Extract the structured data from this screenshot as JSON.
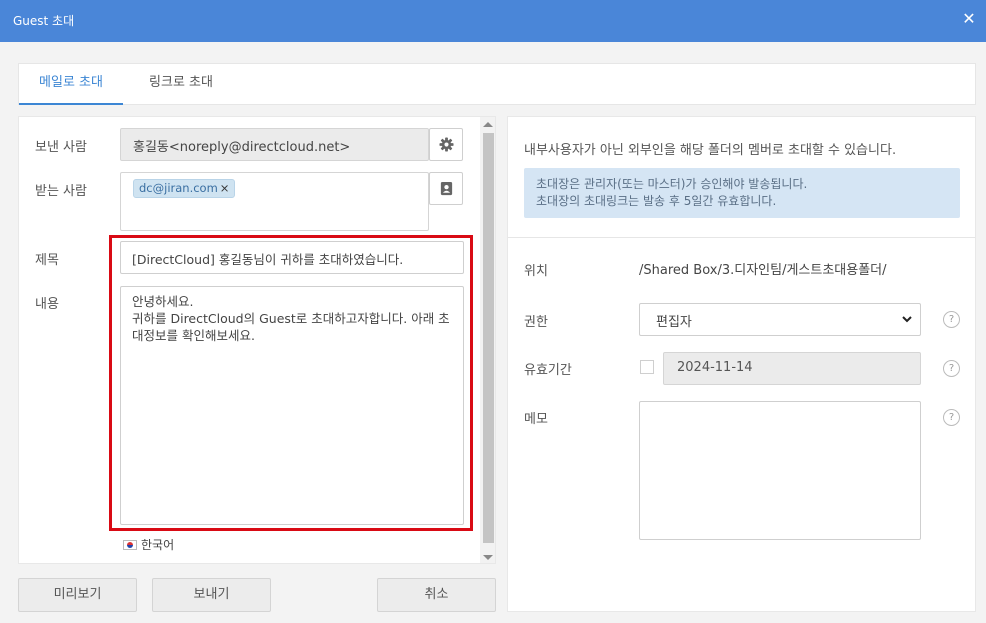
{
  "window": {
    "title": "Guest 초대"
  },
  "tabs": [
    {
      "label": "메일로 초대",
      "active": true
    },
    {
      "label": "링크로 초대",
      "active": false
    }
  ],
  "form": {
    "sender_label": "보낸 사람",
    "sender_value": "홍길동<noreply@directcloud.net>",
    "recipient_label": "받는 사람",
    "recipient_chips": [
      "dc@jiran.com"
    ],
    "subject_label": "제목",
    "subject_value": "[DirectCloud] 홍길동님이 귀하를 초대하였습니다.",
    "body_label": "내용",
    "body_value": "안녕하세요.\n귀하를 DirectCloud의 Guest로 초대하고자합니다. 아래 초대정보를 확인해보세요.",
    "language": "한국어"
  },
  "buttons": {
    "preview": "미리보기",
    "send": "보내기",
    "cancel": "취소"
  },
  "right": {
    "description": "내부사용자가 아닌 외부인을 해당 폴더의 멤버로 초대할 수 있습니다.",
    "info_line1": "초대장은 관리자(또는 마스터)가 승인해야 발송됩니다.",
    "info_line2": "초대장의 초대링크는 발송 후 5일간 유효합니다.",
    "location_label": "위치",
    "location_value": "/Shared Box/3.디자인팀/게스트초대용폴더/",
    "permission_label": "권한",
    "permission_value": "편집자",
    "expiry_label": "유효기간",
    "expiry_checked": false,
    "expiry_value": "2024-11-14",
    "memo_label": "메모",
    "help_glyph": "?"
  },
  "colors": {
    "titlebar": "#4a86d8",
    "accent": "#3c86d4",
    "highlight_frame": "#d90a14",
    "info_bg": "#d5e5f4"
  }
}
